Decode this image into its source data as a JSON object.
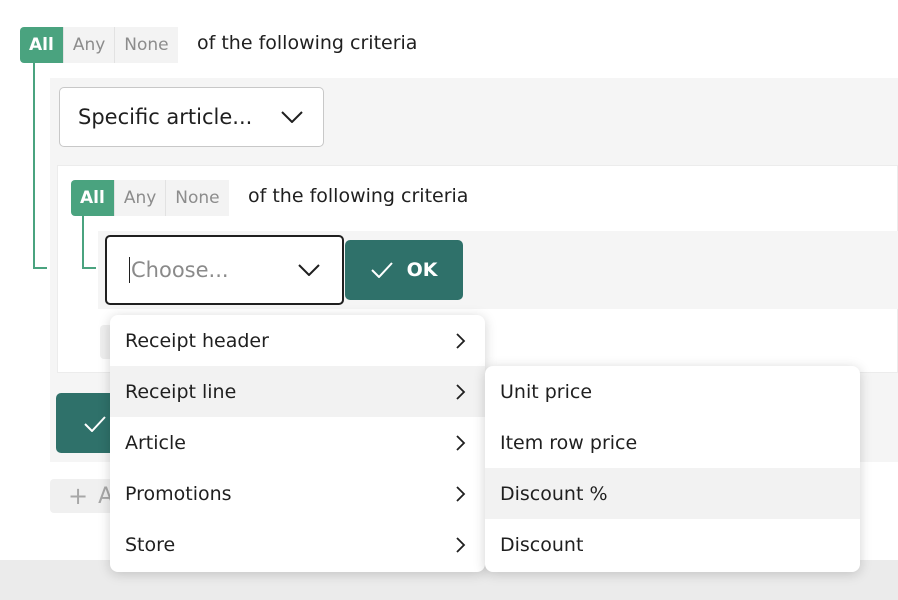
{
  "top_group": {
    "modes": [
      "All",
      "Any",
      "None"
    ],
    "active_mode": "All",
    "criteria_label": "of the following criteria"
  },
  "article_select": {
    "value": "Specific article..."
  },
  "inner_group": {
    "modes": [
      "All",
      "Any",
      "None"
    ],
    "active_mode": "All",
    "criteria_label": "of the following criteria"
  },
  "choose_select": {
    "placeholder": "Choose..."
  },
  "ok_button": {
    "label": "OK"
  },
  "add_button": {
    "label": "A"
  },
  "primary_menu": {
    "items": [
      {
        "label": "Receipt header"
      },
      {
        "label": "Receipt line"
      },
      {
        "label": "Article"
      },
      {
        "label": "Promotions"
      },
      {
        "label": "Store"
      }
    ],
    "highlighted": "Receipt line"
  },
  "submenu": {
    "items": [
      {
        "label": "Unit price"
      },
      {
        "label": "Item row price"
      },
      {
        "label": "Discount %"
      },
      {
        "label": "Discount"
      }
    ],
    "highlighted": "Discount %"
  },
  "colors": {
    "accent_green": "#4aa37f",
    "button_teal": "#2f716a",
    "panel_gray": "#f5f5f5"
  }
}
